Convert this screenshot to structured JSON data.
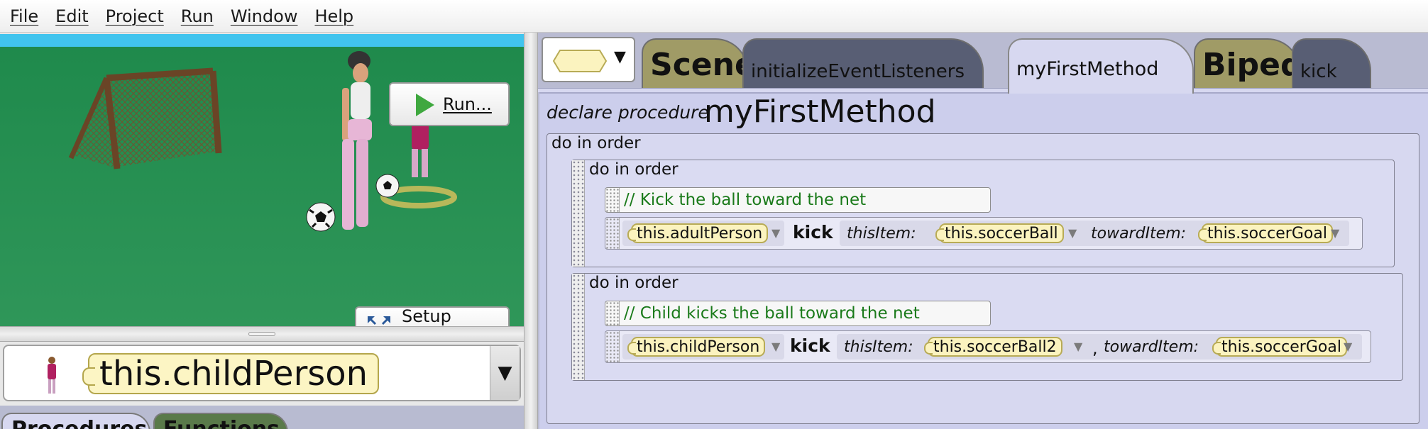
{
  "menu": [
    "File",
    "Edit",
    "Project",
    "Run",
    "Window",
    "Help"
  ],
  "scene": {
    "run_label": "Run...",
    "setup_label": "Setup Scene"
  },
  "selector": {
    "value": "this.childPerson"
  },
  "bottom_tabs": [
    "Procedures",
    "Functions"
  ],
  "tabs": {
    "scene": "Scene",
    "init": "initializeEventListeners",
    "active": "myFirstMethod",
    "biped": "Biped",
    "kick": "kick"
  },
  "editor": {
    "declare": "declare procedure",
    "method_name": "myFirstMethod",
    "outer_block": "do in order",
    "blocks": [
      {
        "header": "do in order",
        "comment": "// Kick the ball toward the net",
        "target": "this.adultPerson",
        "verb": "kick",
        "param1": "thisItem:",
        "arg1": "this.soccerBall",
        "param2": "towardItem:",
        "arg2": "this.soccerGoal"
      },
      {
        "header": "do in order",
        "comment": "// Child kicks the ball toward the net",
        "target": "this.childPerson",
        "verb": "kick",
        "param1": "thisItem:",
        "arg1": "this.soccerBall2",
        "param2": "towardItem:",
        "arg2": "this.soccerGoal"
      }
    ]
  },
  "colors": {
    "pill": "#fbf3bf",
    "comment_text": "#1a7a1a",
    "type_tab": "#a09b66",
    "method_tab": "#585e74",
    "editor_bg": "#ccceec"
  }
}
